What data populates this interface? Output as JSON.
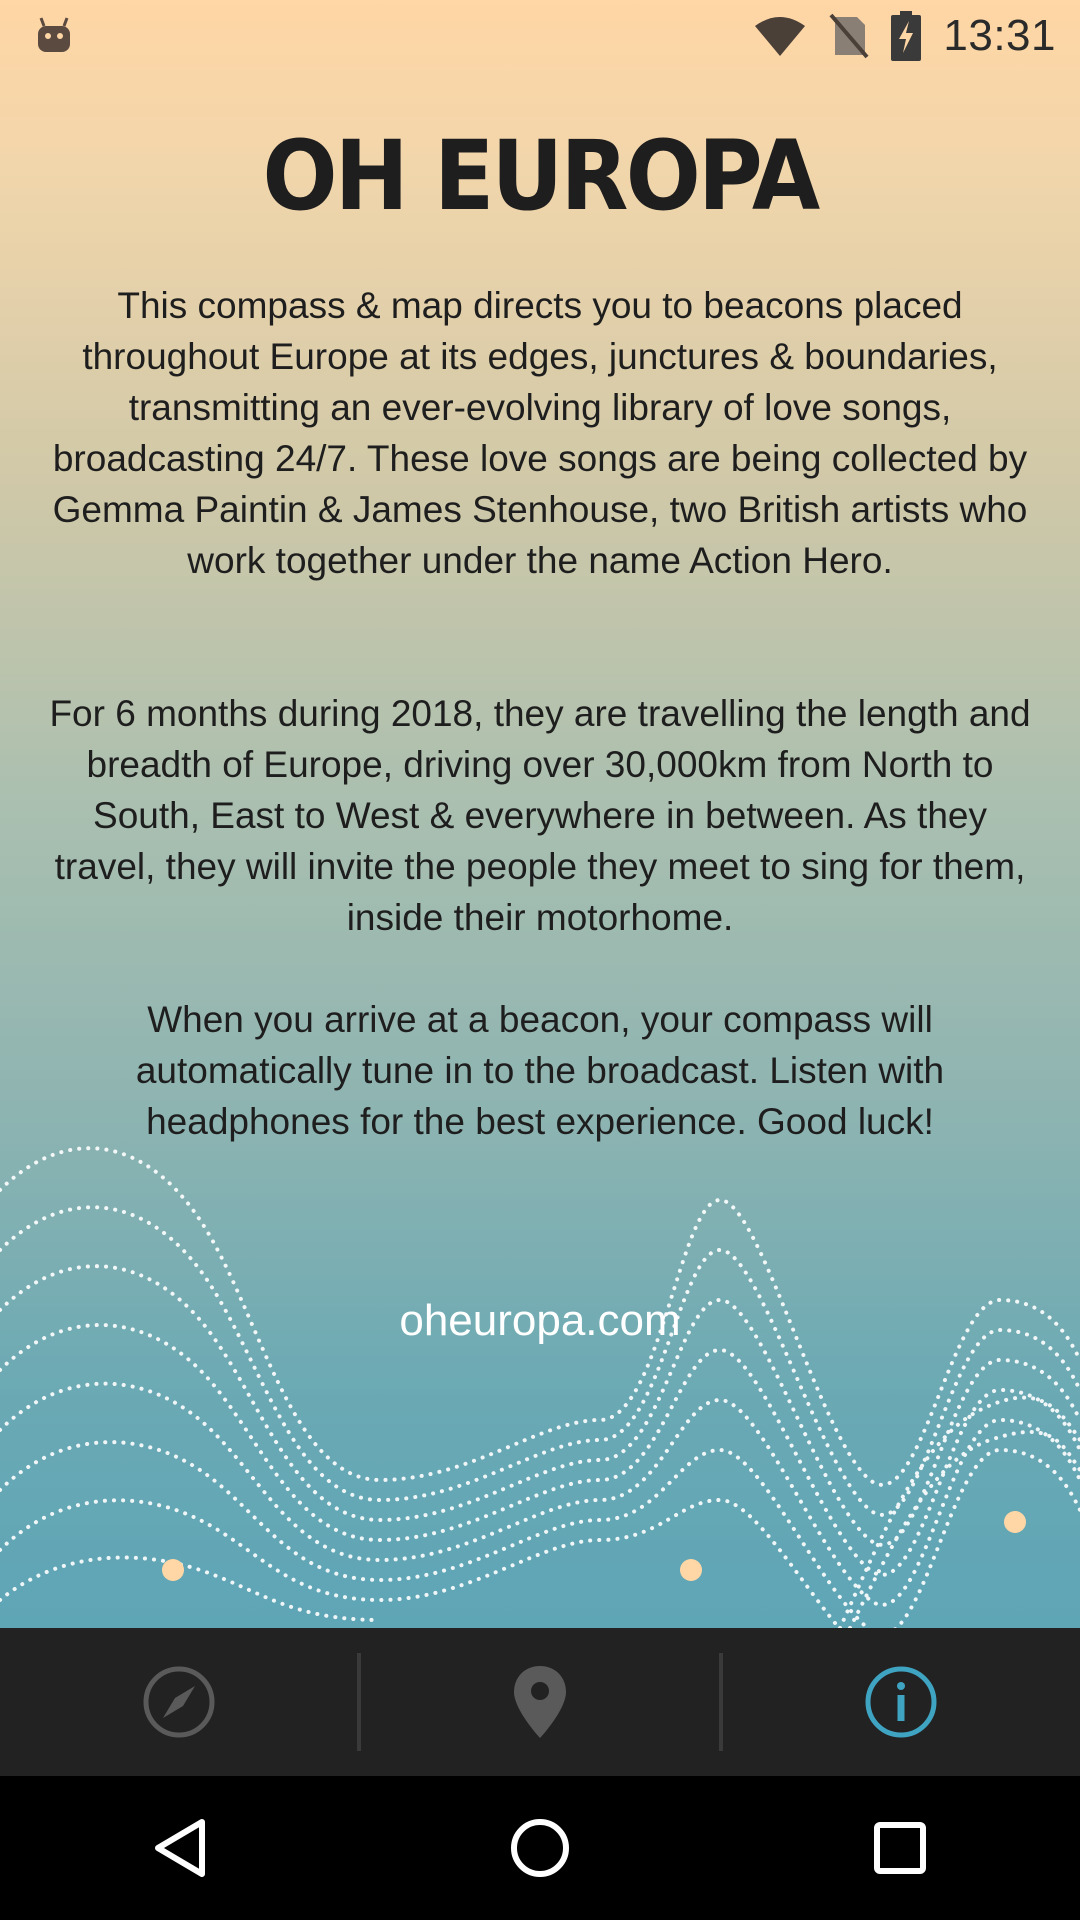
{
  "status_bar": {
    "time": "13:31",
    "icons": [
      "android-debug-icon",
      "wifi-icon",
      "no-sim-icon",
      "battery-charging-icon"
    ]
  },
  "about": {
    "title": "OH EUROPA",
    "paragraphs": [
      "This compass & map directs you to beacons placed throughout Europe at its edges, junctures & boundaries, transmitting an ever-evolving library of love songs, broadcasting 24/7. These love songs are being collected by Gemma Paintin & James Stenhouse, two British artists who work together under the name Action Hero.",
      "For 6 months during 2018, they are travelling the length and breadth of Europe, driving over 30,000km from North to South, East to West & everywhere in between. As they travel, they will invite the people they meet to sing for them, inside their motorhome.",
      "When you arrive at a beacon, your compass will automatically tune in to the broadcast. Listen with headphones for the best experience. Good luck!"
    ],
    "link": "oheuropa.com"
  },
  "tab_bar": {
    "tabs": [
      {
        "name": "compass",
        "icon": "compass-icon",
        "active": false
      },
      {
        "name": "map",
        "icon": "map-pin-icon",
        "active": false
      },
      {
        "name": "info",
        "icon": "info-icon",
        "active": true
      }
    ],
    "active_color": "#3fa3c2",
    "inactive_color": "#5a5a5a"
  },
  "nav_bar": {
    "buttons": [
      "back-icon",
      "home-icon",
      "recents-icon"
    ]
  }
}
